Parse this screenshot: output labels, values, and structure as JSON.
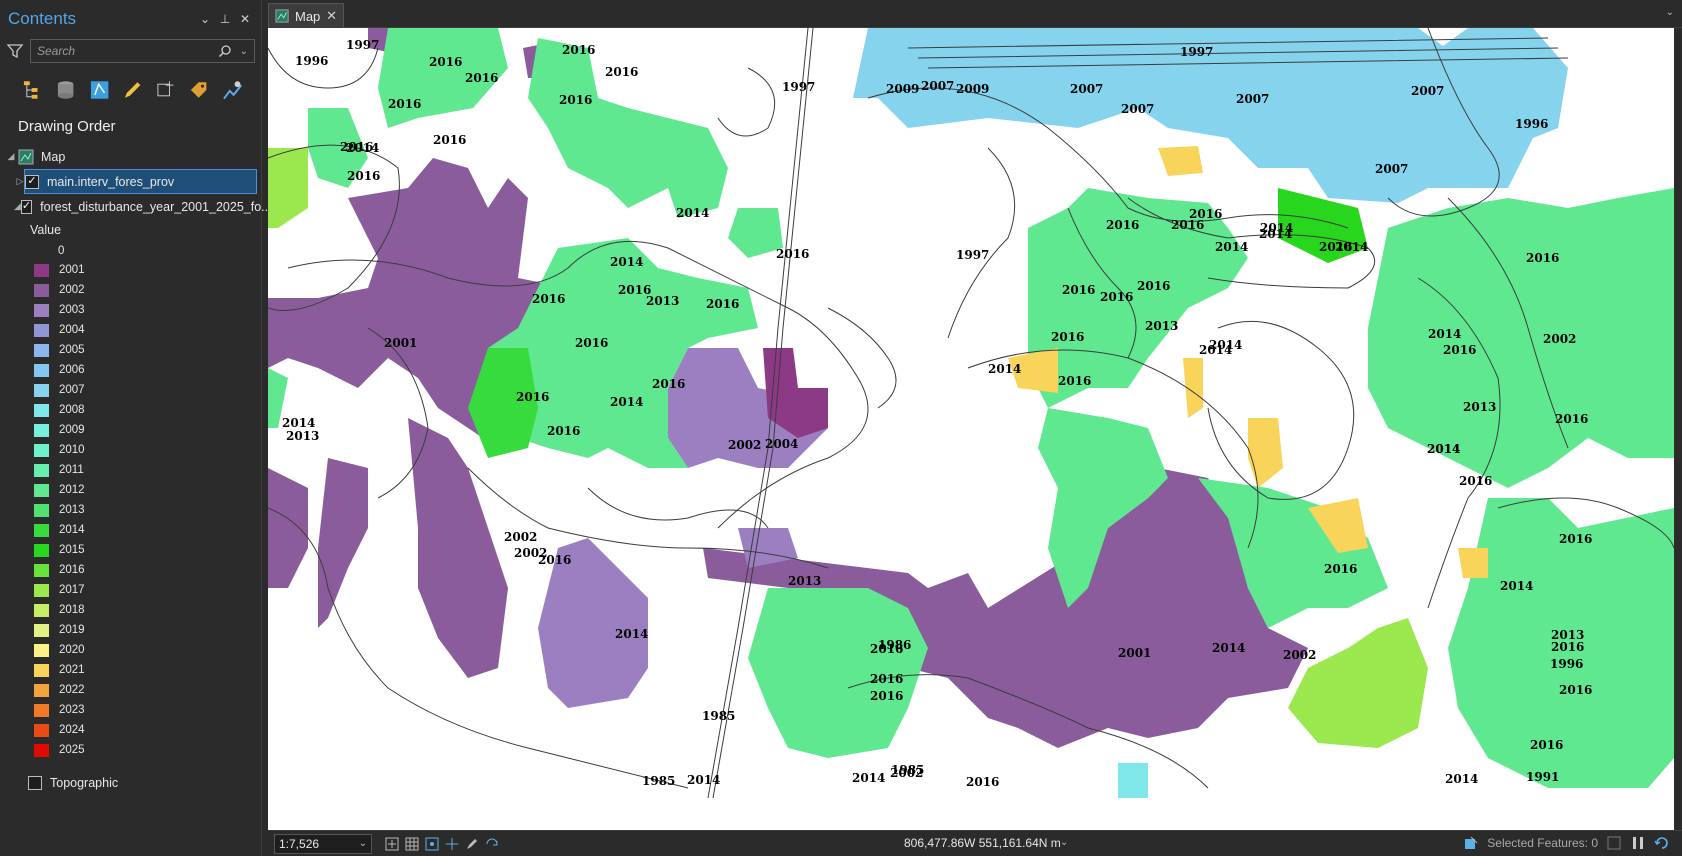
{
  "contents": {
    "title": "Contents",
    "search_placeholder": "Search",
    "section": "Drawing Order",
    "map_name": "Map",
    "layer1": "main.interv_fores_prov",
    "layer2": "forest_disturbance_year_2001_2025_fo...",
    "legend_title": "Value",
    "legend_zero": "0",
    "legend": [
      {
        "label": "2001",
        "color": "#8c3a86"
      },
      {
        "label": "2002",
        "color": "#8b5c9c"
      },
      {
        "label": "2003",
        "color": "#9b7fc0"
      },
      {
        "label": "2004",
        "color": "#8f96d6"
      },
      {
        "label": "2005",
        "color": "#8cb6ee"
      },
      {
        "label": "2006",
        "color": "#84c6f2"
      },
      {
        "label": "2007",
        "color": "#86d3ee"
      },
      {
        "label": "2008",
        "color": "#7fe6ea"
      },
      {
        "label": "2009",
        "color": "#76f0dc"
      },
      {
        "label": "2010",
        "color": "#6ef2cc"
      },
      {
        "label": "2011",
        "color": "#66eeb0"
      },
      {
        "label": "2012",
        "color": "#5fe890"
      },
      {
        "label": "2013",
        "color": "#4fe272"
      },
      {
        "label": "2014",
        "color": "#37db3e"
      },
      {
        "label": "2015",
        "color": "#28d61e"
      },
      {
        "label": "2016",
        "color": "#67e23a"
      },
      {
        "label": "2017",
        "color": "#9ae84e"
      },
      {
        "label": "2018",
        "color": "#c4ee66"
      },
      {
        "label": "2019",
        "color": "#e2f282"
      },
      {
        "label": "2020",
        "color": "#fbf285"
      },
      {
        "label": "2021",
        "color": "#f8d45a"
      },
      {
        "label": "2022",
        "color": "#f4a43c"
      },
      {
        "label": "2023",
        "color": "#f07a28"
      },
      {
        "label": "2024",
        "color": "#ea4a14"
      },
      {
        "label": "2025",
        "color": "#e00a00"
      }
    ],
    "basemap": "Topographic"
  },
  "tab": {
    "label": "Map"
  },
  "status": {
    "scale": "1:7,526",
    "coords": "806,477.86W 551,161.64N m",
    "selected": "Selected Features: 0"
  },
  "map_labels": [
    {
      "t": "1997"
    },
    {
      "t": "1996"
    },
    {
      "t": "2016"
    },
    {
      "t": "2016"
    },
    {
      "t": "2016"
    },
    {
      "t": "2016"
    },
    {
      "t": "2016"
    },
    {
      "t": "2016"
    },
    {
      "t": "2016"
    },
    {
      "t": "2014"
    },
    {
      "t": "2016"
    },
    {
      "t": "2016"
    },
    {
      "t": "1997"
    },
    {
      "t": "2009"
    },
    {
      "t": "2007"
    },
    {
      "t": "2009"
    },
    {
      "t": "2007"
    },
    {
      "t": "2007"
    },
    {
      "t": "2007"
    },
    {
      "t": "1997"
    },
    {
      "t": "2007"
    },
    {
      "t": "2007"
    },
    {
      "t": "1996"
    },
    {
      "t": "2014"
    },
    {
      "t": "2016"
    },
    {
      "t": "1997"
    },
    {
      "t": "2014"
    },
    {
      "t": "2016"
    },
    {
      "t": "2013"
    },
    {
      "t": "2016"
    },
    {
      "t": "2016"
    },
    {
      "t": "2001"
    },
    {
      "t": "2016"
    },
    {
      "t": "2016"
    },
    {
      "t": "2014"
    },
    {
      "t": "2016"
    },
    {
      "t": "2002"
    },
    {
      "t": "2004"
    },
    {
      "t": "2014"
    },
    {
      "t": "2013"
    },
    {
      "t": "2016"
    },
    {
      "t": "2016"
    },
    {
      "t": "2016"
    },
    {
      "t": "2016"
    },
    {
      "t": "2014"
    },
    {
      "t": "2014"
    },
    {
      "t": "2014"
    },
    {
      "t": "2016"
    },
    {
      "t": "2014"
    },
    {
      "t": "2016"
    },
    {
      "t": "2016"
    },
    {
      "t": "2016"
    },
    {
      "t": "2014"
    },
    {
      "t": "2014"
    },
    {
      "t": "2016"
    },
    {
      "t": "2013"
    },
    {
      "t": "2014"
    },
    {
      "t": "2016"
    },
    {
      "t": "2014"
    },
    {
      "t": "2016"
    },
    {
      "t": "2016"
    },
    {
      "t": "2016"
    },
    {
      "t": "2002"
    },
    {
      "t": "2016"
    },
    {
      "t": "2013"
    },
    {
      "t": "2014"
    },
    {
      "t": "2014"
    },
    {
      "t": "2002"
    },
    {
      "t": "2002"
    },
    {
      "t": "2016"
    },
    {
      "t": "2013"
    },
    {
      "t": "2014"
    },
    {
      "t": "2001"
    },
    {
      "t": "2014"
    },
    {
      "t": "2002"
    },
    {
      "t": "2016"
    },
    {
      "t": "2016"
    },
    {
      "t": "2014"
    },
    {
      "t": "2013"
    },
    {
      "t": "2016"
    },
    {
      "t": "1996"
    },
    {
      "t": "2016"
    },
    {
      "t": "2016"
    },
    {
      "t": "1991"
    },
    {
      "t": "1985"
    },
    {
      "t": "1986"
    },
    {
      "t": "1985"
    },
    {
      "t": "1985"
    },
    {
      "t": "2014"
    },
    {
      "t": "2014"
    },
    {
      "t": "2016"
    },
    {
      "t": "2014"
    },
    {
      "t": "2016"
    },
    {
      "t": "2016"
    },
    {
      "t": "2016"
    },
    {
      "t": "2002"
    }
  ]
}
